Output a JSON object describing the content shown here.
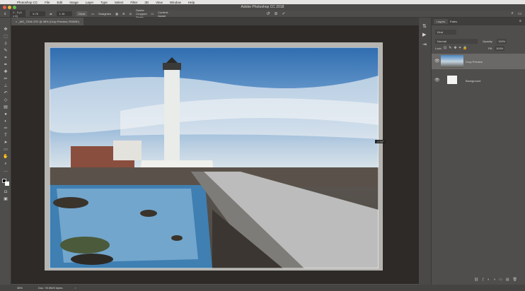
{
  "menubar": {
    "items": [
      "Photoshop CC",
      "File",
      "Edit",
      "Image",
      "Layer",
      "Type",
      "Select",
      "Filter",
      "3D",
      "View",
      "Window",
      "Help"
    ]
  },
  "title": "Adobe Photoshop CC 2018",
  "options": {
    "ratio": "2 : 3 (4 x 6)",
    "width": "5.76",
    "height": "1.15",
    "clear": "Clear",
    "straighten": "Straighten",
    "delete_cropped": "Delete Cropped Pixels",
    "content_aware": "Content-Aware",
    "delete_checked": true,
    "content_aware_checked": false
  },
  "document": {
    "tab": "_MG_7518.CR2 @ 38% (Crop Preview, RGB/8*)",
    "angle": "-0.00°"
  },
  "layers_panel": {
    "tabs": [
      "Layers",
      "Paths"
    ],
    "kind": "Kind",
    "blend": "Normal",
    "opacity_label": "Opacity:",
    "opacity": "100%",
    "lock_label": "Lock:",
    "fill_label": "Fill:",
    "fill": "100%",
    "layers": [
      {
        "name": "Crop Preview",
        "selected": true
      },
      {
        "name": "Background",
        "selected": false
      }
    ]
  },
  "status": {
    "zoom": "38%",
    "doc": "Doc: 78.9M/0 bytes"
  }
}
